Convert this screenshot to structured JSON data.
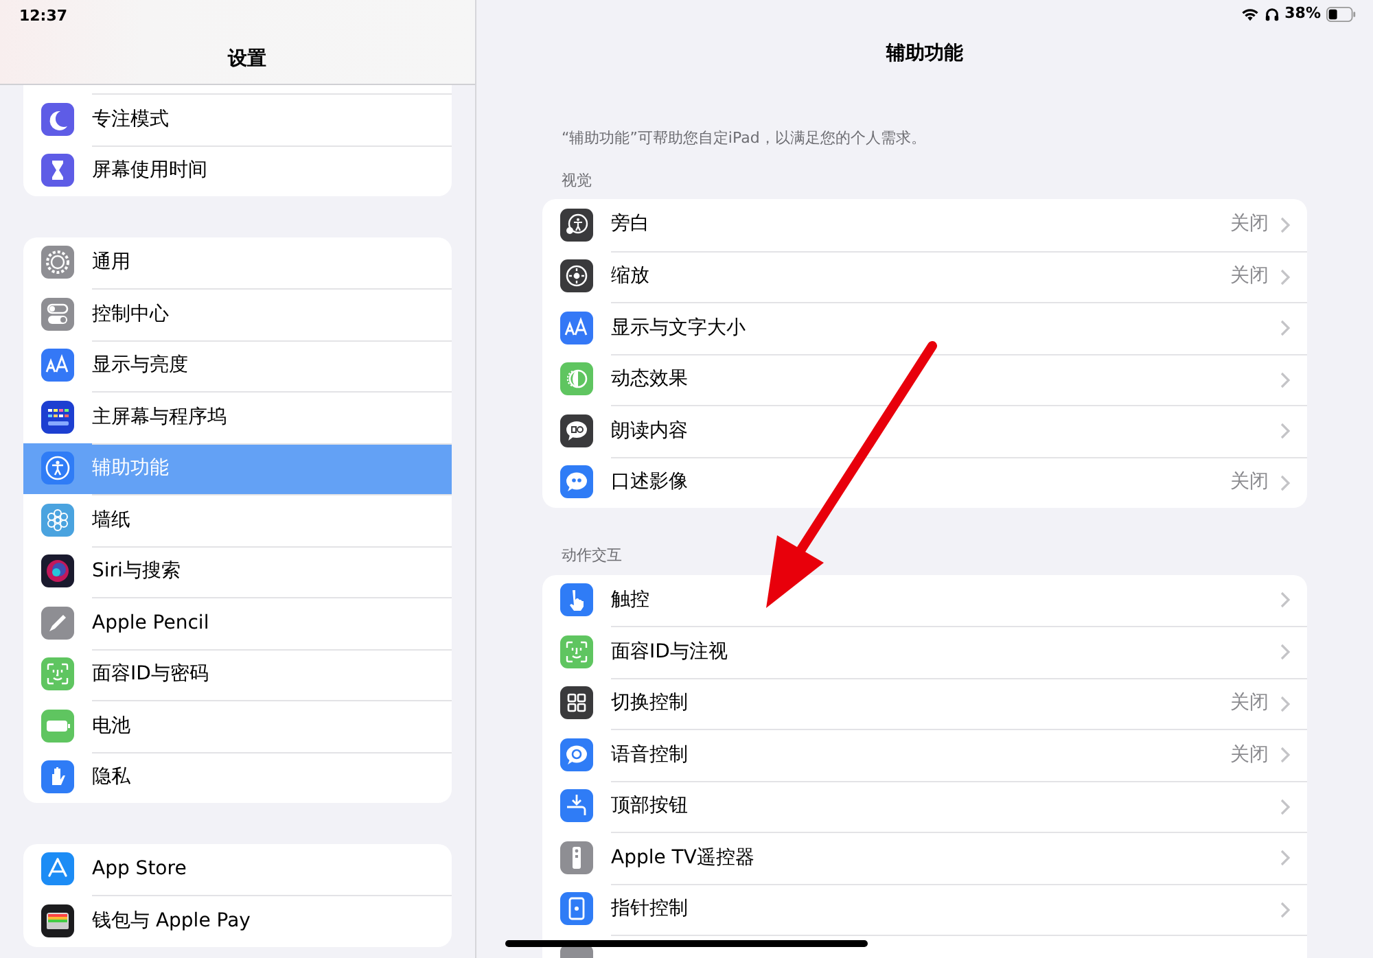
{
  "status_bar": {
    "time": "12:37",
    "battery": "38%"
  },
  "sidebar": {
    "title": "设置",
    "groups": [
      {
        "partial_top": true,
        "items": [
          {
            "label": "专注模式",
            "kind": "moon",
            "selected": false
          },
          {
            "label": "屏幕使用时间",
            "kind": "hourglass",
            "selected": false
          }
        ]
      },
      {
        "partial_top": false,
        "items": [
          {
            "label": "通用",
            "kind": "gear",
            "selected": false
          },
          {
            "label": "控制中心",
            "kind": "toggles",
            "selected": false
          },
          {
            "label": "显示与亮度",
            "kind": "textsize",
            "selected": false
          },
          {
            "label": "主屏幕与程序坞",
            "kind": "grid",
            "selected": false
          },
          {
            "label": "辅助功能",
            "kind": "accessibility",
            "selected": true
          },
          {
            "label": "墙纸",
            "kind": "flower",
            "selected": false
          },
          {
            "label": "Siri与搜索",
            "kind": "siri",
            "selected": false
          },
          {
            "label": "Apple Pencil",
            "kind": "pencil",
            "selected": false
          },
          {
            "label": "面容ID与密码",
            "kind": "faceid",
            "selected": false
          },
          {
            "label": "电池",
            "kind": "battery",
            "selected": false
          },
          {
            "label": "隐私",
            "kind": "hand",
            "selected": false
          }
        ]
      },
      {
        "partial_top": false,
        "items": [
          {
            "label": "App Store",
            "kind": "appstore",
            "selected": false
          },
          {
            "label": "钱包与 Apple Pay",
            "kind": "wallet",
            "selected": false
          }
        ]
      }
    ]
  },
  "detail": {
    "title": "辅助功能",
    "description": "“辅助功能”可帮助您自定iPad，以满足您的个人需求。",
    "sections": [
      {
        "header": "视觉",
        "rows": [
          {
            "label": "旁白",
            "kind": "voiceover",
            "value": "关闭"
          },
          {
            "label": "缩放",
            "kind": "zoom",
            "value": "关闭"
          },
          {
            "label": "显示与文字大小",
            "kind": "textsize"
          },
          {
            "label": "动态效果",
            "kind": "motion"
          },
          {
            "label": "朗读内容",
            "kind": "speech"
          },
          {
            "label": "口述影像",
            "kind": "audiodesc",
            "value": "关闭"
          }
        ]
      },
      {
        "header": "动作交互",
        "rows": [
          {
            "label": "触控",
            "kind": "touch"
          },
          {
            "label": "面容ID与注视",
            "kind": "faceid"
          },
          {
            "label": "切换控制",
            "kind": "switch",
            "value": "关闭"
          },
          {
            "label": "语音控制",
            "kind": "voicecontrol",
            "value": "关闭"
          },
          {
            "label": "顶部按钮",
            "kind": "topbutton"
          },
          {
            "label": "Apple TV遥控器",
            "kind": "remote"
          },
          {
            "label": "指针控制",
            "kind": "pointer"
          },
          {
            "kind": "blank"
          }
        ]
      }
    ]
  },
  "annotation": {
    "kind": "arrow"
  }
}
